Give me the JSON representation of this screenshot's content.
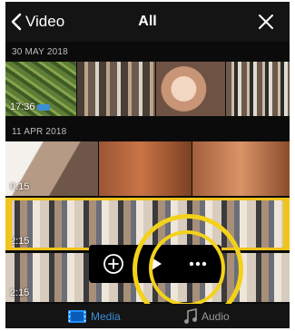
{
  "header": {
    "back_label": "Video",
    "title": "All"
  },
  "sections": [
    {
      "date": "30 MAY 2018",
      "first_clip_duration": "17:36"
    },
    {
      "date": "11 APR 2018",
      "first_clip_duration": "0:15"
    }
  ],
  "selected_row": {
    "duration": "2:15"
  },
  "last_row": {
    "duration": "2:15"
  },
  "popup": {
    "add": "add-clip",
    "play": "play-clip",
    "more": "more-options"
  },
  "tabs": [
    {
      "label": "Media",
      "icon": "film-icon",
      "active": true
    },
    {
      "label": "Audio",
      "icon": "music-note-icon",
      "active": false
    }
  ],
  "colors": {
    "accent": "#3b8fd6",
    "selection": "#f2c31b",
    "highlight": "#f3d21a"
  }
}
